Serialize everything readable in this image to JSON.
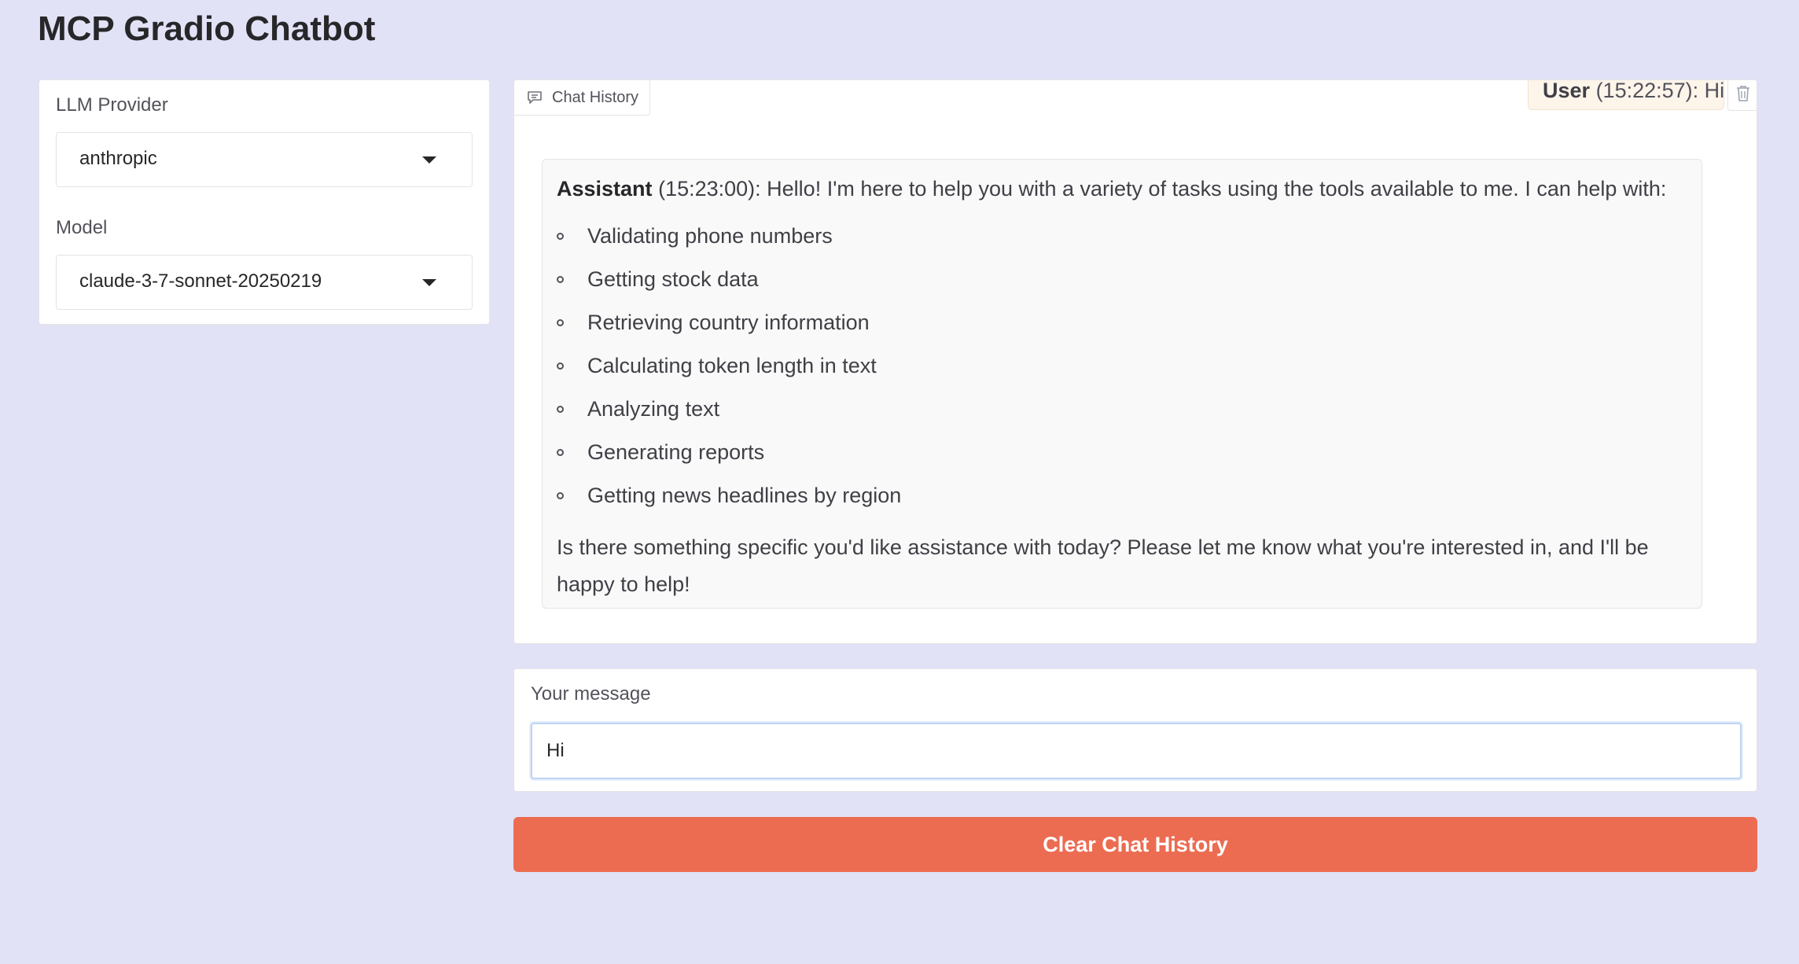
{
  "app": {
    "title": "MCP Gradio Chatbot"
  },
  "settings": {
    "provider_label": "LLM Provider",
    "provider_value": "anthropic",
    "model_label": "Model",
    "model_value": "claude-3-7-sonnet-20250219"
  },
  "chat": {
    "label": "Chat History",
    "user_message": {
      "speaker": "User",
      "time": "(15:22:57)",
      "text": "Hi"
    },
    "assistant_message": {
      "speaker": "Assistant",
      "time": "(15:23:00)",
      "intro": "Hello! I'm here to help you with a variety of tasks using the tools available to me. I can help with:",
      "items": [
        "Validating phone numbers",
        "Getting stock data",
        "Retrieving country information",
        "Calculating token length in text",
        "Analyzing text",
        "Generating reports",
        "Getting news headlines by region"
      ],
      "outro": "Is there something specific you'd like assistance with today? Please let me know what you're interested in, and I'll be happy to help!"
    }
  },
  "message_box": {
    "label": "Your message",
    "value": "Hi"
  },
  "actions": {
    "clear_label": "Clear Chat History"
  },
  "icons": {
    "chat_label_icon": "chat-bubble-icon",
    "clear_icon": "trash-icon",
    "dropdown_icon": "caret-down-icon"
  },
  "colors": {
    "background": "#e1e2f6",
    "clear_button": "#ec6c52",
    "user_bubble": "#fdf4ea",
    "assistant_bubble": "#f9f9f9"
  }
}
